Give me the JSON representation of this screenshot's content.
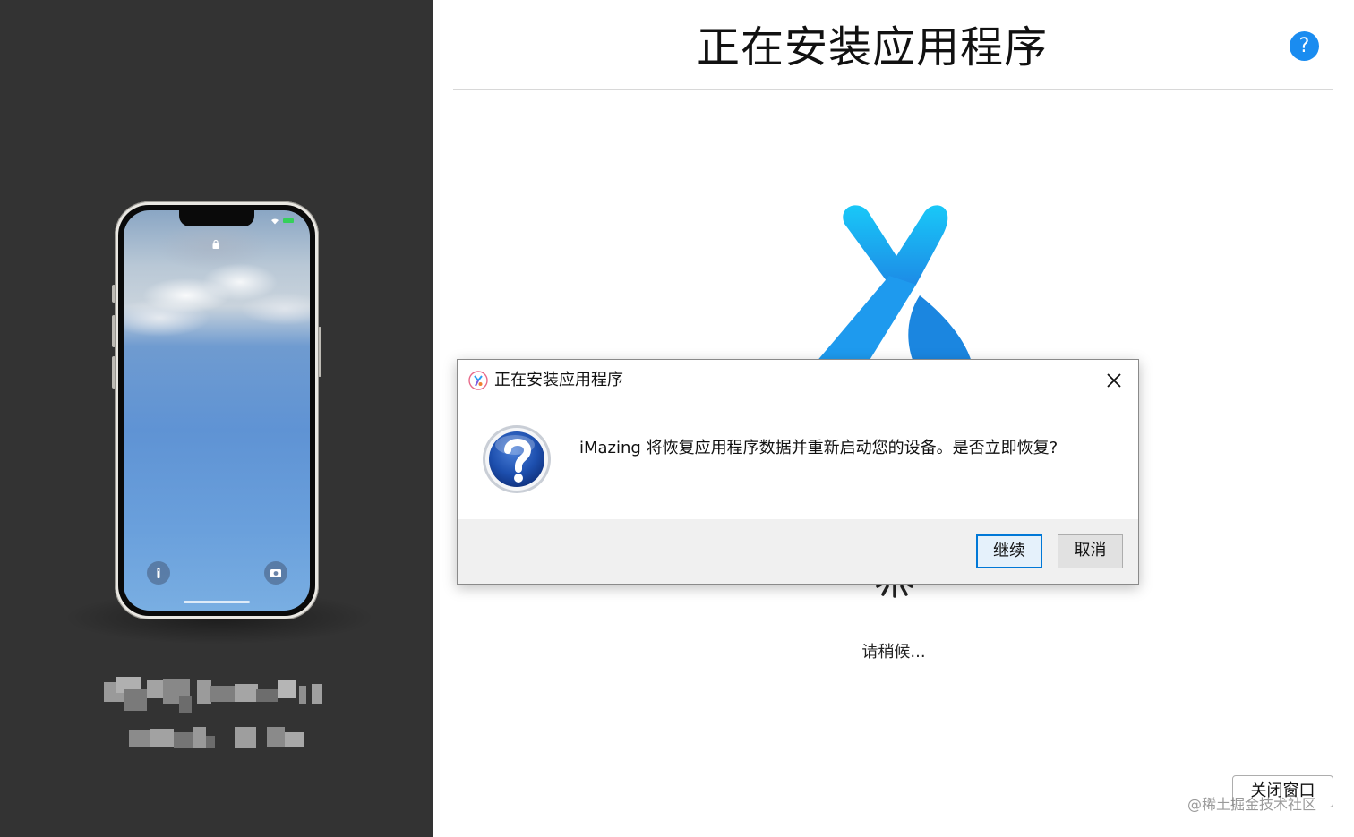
{
  "main": {
    "title": "正在安装应用程序",
    "help_glyph": "?",
    "wait_text": "请稍候...",
    "close_window_label": "关闭窗口",
    "watermark": "@稀土掘金技术社区"
  },
  "dialog": {
    "title": "正在安装应用程序",
    "message": "iMazing 将恢复应用程序数据并重新启动您的设备。是否立即恢复?",
    "continue_label": "继续",
    "cancel_label": "取消"
  },
  "icons": {
    "help": "help-icon",
    "app_logo": "imazing-logo",
    "dialog_app": "imazing-small-icon",
    "dialog_close": "close-icon",
    "dialog_question": "question-icon",
    "spinner": "loading-spinner-icon",
    "phone_lock": "lock-icon",
    "phone_flashlight": "flashlight-icon",
    "phone_camera": "camera-icon"
  },
  "colors": {
    "left_panel": "#333333",
    "accent": "#1a8cf0",
    "dialog_default_border": "#0078d7"
  }
}
